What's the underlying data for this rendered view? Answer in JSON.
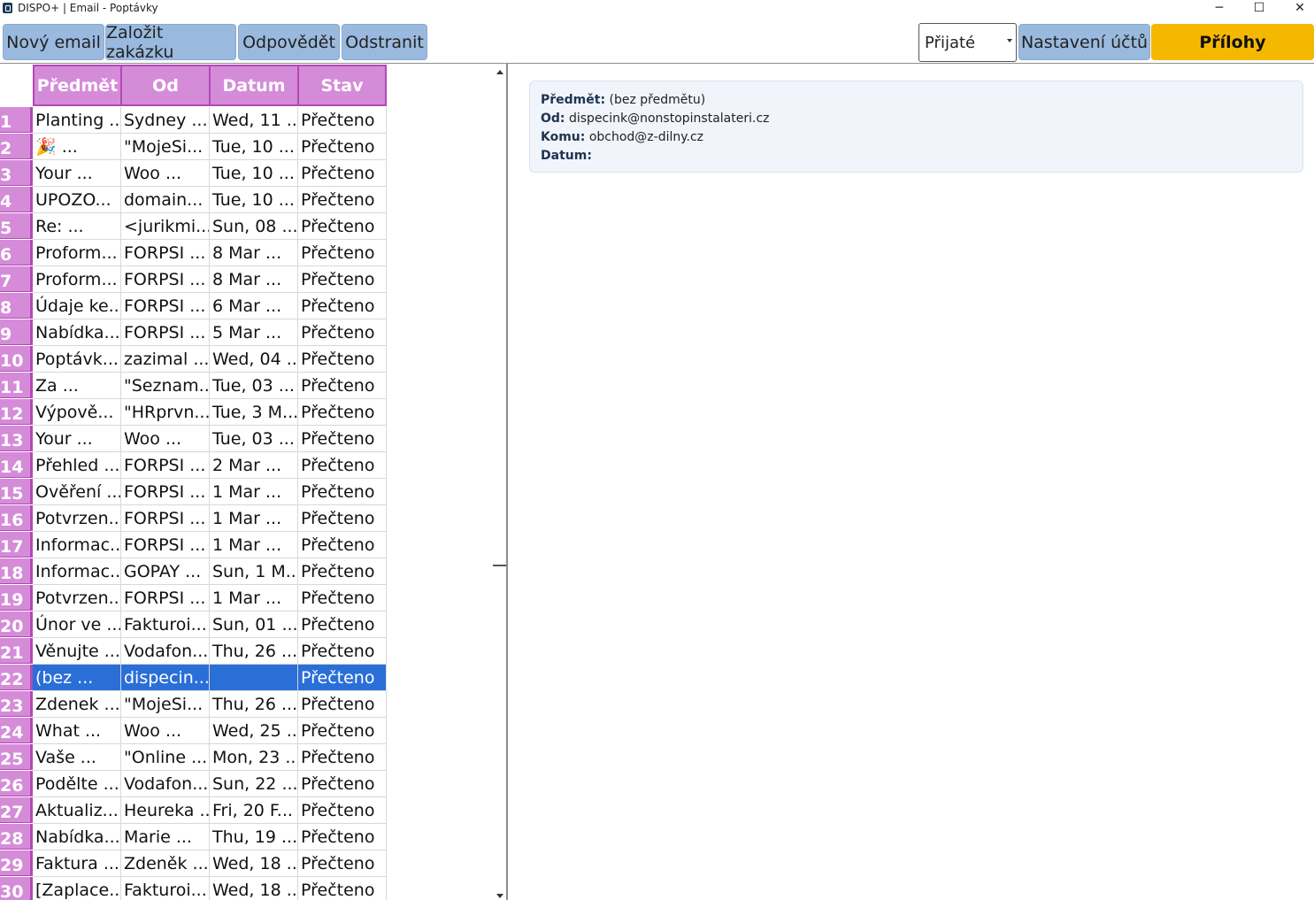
{
  "window": {
    "title": "DISPO+ | Email - Poptávky",
    "controls": [
      "─",
      "☐",
      "✕"
    ]
  },
  "toolbar": {
    "new_email": "Nový email",
    "create_order": "Založit zakázku",
    "reply": "Odpovědět",
    "delete": "Odstranit",
    "folder_select": "Přijaté",
    "account_settings": "Nastavení účtů",
    "attachments": "Přílohy"
  },
  "colors": {
    "header_bg": "#d58cd8",
    "header_border": "#b348b8",
    "button_bg": "#9ab9de",
    "attachments_bg": "#f5b800",
    "selected_row": "#2a6fd8"
  },
  "grid": {
    "columns": [
      "Předmět",
      "Od",
      "Datum",
      "Stav"
    ],
    "selected_index": 21,
    "rows": [
      {
        "n": "1",
        "subject": "Planting ...",
        "from": "Sydney ...",
        "date": "Wed, 11 ...",
        "status": "Přečteno"
      },
      {
        "n": "2",
        "subject": "🎉 ...",
        "from": "\"MojeSi...",
        "date": "Tue, 10 ...",
        "status": "Přečteno"
      },
      {
        "n": "3",
        "subject": "Your ...",
        "from": "Woo ...",
        "date": "Tue, 10 ...",
        "status": "Přečteno"
      },
      {
        "n": "4",
        "subject": "UPOZO...",
        "from": "domain...",
        "date": "Tue, 10 ...",
        "status": "Přečteno"
      },
      {
        "n": "5",
        "subject": "Re: ...",
        "from": "<jurikmi...",
        "date": "Sun, 08 ...",
        "status": "Přečteno"
      },
      {
        "n": "6",
        "subject": "Proform...",
        "from": "FORPSI ...",
        "date": "8 Mar ...",
        "status": "Přečteno"
      },
      {
        "n": "7",
        "subject": "Proform...",
        "from": "FORPSI ...",
        "date": "8 Mar ...",
        "status": "Přečteno"
      },
      {
        "n": "8",
        "subject": "Údaje ke...",
        "from": "FORPSI ...",
        "date": "6 Mar ...",
        "status": "Přečteno"
      },
      {
        "n": "9",
        "subject": "Nabídka...",
        "from": "FORPSI ...",
        "date": "5 Mar ...",
        "status": "Přečteno"
      },
      {
        "n": "10",
        "subject": "Poptávk...",
        "from": "zazimal ...",
        "date": "Wed, 04 ...",
        "status": "Přečteno"
      },
      {
        "n": "11",
        "subject": "Za ...",
        "from": "\"Seznam...",
        "date": "Tue, 03 ...",
        "status": "Přečteno"
      },
      {
        "n": "12",
        "subject": "Výpově...",
        "from": "\"HRprvn...",
        "date": "Tue, 3 M...",
        "status": "Přečteno"
      },
      {
        "n": "13",
        "subject": "Your ...",
        "from": "Woo ...",
        "date": "Tue, 03 ...",
        "status": "Přečteno"
      },
      {
        "n": "14",
        "subject": "Přehled ...",
        "from": "FORPSI ...",
        "date": "2 Mar ...",
        "status": "Přečteno"
      },
      {
        "n": "15",
        "subject": "Ověření ...",
        "from": "FORPSI ...",
        "date": "1 Mar ...",
        "status": "Přečteno"
      },
      {
        "n": "16",
        "subject": "Potvrzen...",
        "from": "FORPSI ...",
        "date": "1 Mar ...",
        "status": "Přečteno"
      },
      {
        "n": "17",
        "subject": "Informac...",
        "from": "FORPSI ...",
        "date": "1 Mar ...",
        "status": "Přečteno"
      },
      {
        "n": "18",
        "subject": "Informac...",
        "from": "GOPAY ...",
        "date": "Sun, 1 M...",
        "status": "Přečteno"
      },
      {
        "n": "19",
        "subject": "Potvrzen...",
        "from": "FORPSI ...",
        "date": "1 Mar ...",
        "status": "Přečteno"
      },
      {
        "n": "20",
        "subject": "Únor ve ...",
        "from": "Fakturoi...",
        "date": "Sun, 01 ...",
        "status": "Přečteno"
      },
      {
        "n": "21",
        "subject": "Věnujte ...",
        "from": "Vodafon...",
        "date": "Thu, 26 ...",
        "status": "Přečteno"
      },
      {
        "n": "22",
        "subject": "(bez ...",
        "from": "dispecin...",
        "date": "",
        "status": "Přečteno"
      },
      {
        "n": "23",
        "subject": "Zdenek ...",
        "from": "\"MojeSi...",
        "date": "Thu, 26 ...",
        "status": "Přečteno"
      },
      {
        "n": "24",
        "subject": "What ...",
        "from": "Woo ...",
        "date": "Wed, 25 ...",
        "status": "Přečteno"
      },
      {
        "n": "25",
        "subject": "Vaše ...",
        "from": "\"Online ...",
        "date": "Mon, 23 ...",
        "status": "Přečteno"
      },
      {
        "n": "26",
        "subject": "Podělte ...",
        "from": "Vodafon...",
        "date": "Sun, 22 ...",
        "status": "Přečteno"
      },
      {
        "n": "27",
        "subject": "Aktualiz...",
        "from": "Heureka ...",
        "date": "Fri, 20 F...",
        "status": "Přečteno"
      },
      {
        "n": "28",
        "subject": "Nabídka...",
        "from": "Marie ...",
        "date": "Thu, 19 ...",
        "status": "Přečteno"
      },
      {
        "n": "29",
        "subject": "Faktura ...",
        "from": "Zdeněk ...",
        "date": "Wed, 18 ...",
        "status": "Přečteno"
      },
      {
        "n": "30",
        "subject": "[Zaplace...",
        "from": "Fakturoi...",
        "date": "Wed, 18 ...",
        "status": "Přečteno"
      }
    ]
  },
  "detail": {
    "subject_label": "Předmět:",
    "subject": "(bez předmětu)",
    "from_label": "Od:",
    "from": "dispecink@nonstopinstalateri.cz",
    "to_label": "Komu:",
    "to": "obchod@z-dilny.cz",
    "date_label": "Datum:",
    "date": ""
  }
}
